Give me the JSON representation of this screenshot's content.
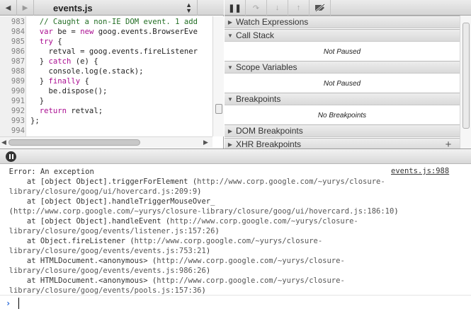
{
  "source_toolbar": {
    "back_icon": "triangle-left-icon",
    "forward_icon": "triangle-right-icon",
    "file_name": "events.js"
  },
  "code": {
    "lines": [
      {
        "num": "983",
        "parts": [
          {
            "t": "  ",
            "c": ""
          },
          {
            "t": "// Caught a non-IE DOM event. 1 add",
            "c": "cm"
          }
        ]
      },
      {
        "num": "984",
        "parts": [
          {
            "t": "  ",
            "c": ""
          },
          {
            "t": "var",
            "c": "kw"
          },
          {
            "t": " be = ",
            "c": ""
          },
          {
            "t": "new",
            "c": "kw"
          },
          {
            "t": " goog.events.BrowserEve",
            "c": ""
          }
        ]
      },
      {
        "num": "985",
        "parts": [
          {
            "t": "  ",
            "c": ""
          },
          {
            "t": "try",
            "c": "kw"
          },
          {
            "t": " {",
            "c": ""
          }
        ]
      },
      {
        "num": "986",
        "parts": [
          {
            "t": "    retval = goog.events.fireListener",
            "c": ""
          }
        ]
      },
      {
        "num": "987",
        "parts": [
          {
            "t": "  } ",
            "c": ""
          },
          {
            "t": "catch",
            "c": "kw"
          },
          {
            "t": " (e) {",
            "c": ""
          }
        ]
      },
      {
        "num": "988",
        "parts": [
          {
            "t": "    console.log(e.stack);",
            "c": ""
          }
        ]
      },
      {
        "num": "989",
        "parts": [
          {
            "t": "  } ",
            "c": ""
          },
          {
            "t": "finally",
            "c": "kw"
          },
          {
            "t": " {",
            "c": ""
          }
        ]
      },
      {
        "num": "990",
        "parts": [
          {
            "t": "    be.dispose();",
            "c": ""
          }
        ]
      },
      {
        "num": "991",
        "parts": [
          {
            "t": "  }",
            "c": ""
          }
        ]
      },
      {
        "num": "992",
        "parts": [
          {
            "t": "  ",
            "c": ""
          },
          {
            "t": "return",
            "c": "kw"
          },
          {
            "t": " retval;",
            "c": ""
          }
        ]
      },
      {
        "num": "993",
        "parts": [
          {
            "t": "};",
            "c": ""
          }
        ]
      },
      {
        "num": "994",
        "parts": [
          {
            "t": "",
            "c": ""
          }
        ]
      }
    ]
  },
  "sidebar": {
    "sections": [
      {
        "title": "Watch Expressions",
        "expanded": false,
        "body": ""
      },
      {
        "title": "Call Stack",
        "expanded": true,
        "body": "Not Paused"
      },
      {
        "title": "Scope Variables",
        "expanded": true,
        "body": "Not Paused"
      },
      {
        "title": "Breakpoints",
        "expanded": true,
        "body": "No Breakpoints"
      },
      {
        "title": "DOM Breakpoints",
        "expanded": false,
        "body": ""
      },
      {
        "title": "XHR Breakpoints",
        "expanded": false,
        "body": ""
      }
    ],
    "add_icon_label": "+"
  },
  "console": {
    "error_source": "events.js:988",
    "lines": [
      {
        "prefix": "  ",
        "text": "Error: An exception",
        "url": "",
        "suffix": ""
      },
      {
        "prefix": "      at [object Object].triggerForElement (",
        "text": "",
        "url": "http://www.corp.google.com/~yurys/closure-",
        "suffix": ""
      },
      {
        "prefix": "  ",
        "text": "",
        "url": "library/closure/goog/ui/hovercard.js:209:9",
        "suffix": ")"
      },
      {
        "prefix": "      at [object Object].handleTriggerMouseOver_",
        "text": "",
        "url": "",
        "suffix": ""
      },
      {
        "prefix": "  (",
        "text": "",
        "url": "http://www.corp.google.com/~yurys/closure-library/closure/goog/ui/hovercard.js:186:10",
        "suffix": ")"
      },
      {
        "prefix": "      at [object Object].handleEvent (",
        "text": "",
        "url": "http://www.corp.google.com/~yurys/closure-",
        "suffix": ""
      },
      {
        "prefix": "  ",
        "text": "",
        "url": "library/closure/goog/events/listener.js:157:26",
        "suffix": ")"
      },
      {
        "prefix": "      at Object.fireListener (",
        "text": "",
        "url": "http://www.corp.google.com/~yurys/closure-",
        "suffix": ""
      },
      {
        "prefix": "  ",
        "text": "",
        "url": "library/closure/goog/events/events.js:753:21",
        "suffix": ")"
      },
      {
        "prefix": "      at HTMLDocument.<anonymous> (",
        "text": "",
        "url": "http://www.corp.google.com/~yurys/closure-",
        "suffix": ""
      },
      {
        "prefix": "  ",
        "text": "",
        "url": "library/closure/goog/events/events.js:986:26",
        "suffix": ")"
      },
      {
        "prefix": "      at HTMLDocument.<anonymous> (",
        "text": "",
        "url": "http://www.corp.google.com/~yurys/closure-",
        "suffix": ""
      },
      {
        "prefix": "  ",
        "text": "",
        "url": "library/closure/goog/events/pools.js:157:36",
        "suffix": ")"
      }
    ],
    "prompt": "›",
    "input_value": ""
  }
}
